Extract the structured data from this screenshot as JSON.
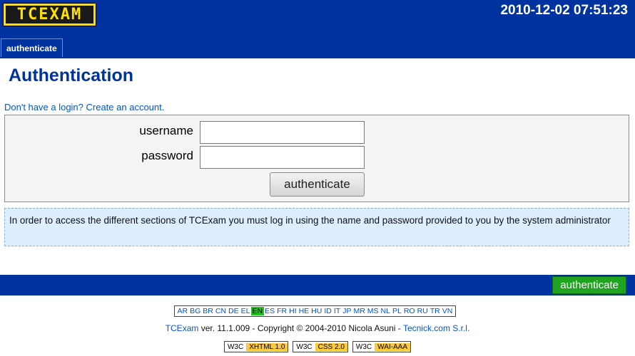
{
  "header": {
    "logo_text": "TCEXAM",
    "datetime": "2010-12-02 07:51:23",
    "menu_tab": "authenticate",
    "bg_color": "#0033a0"
  },
  "main": {
    "title": "Authentication",
    "create_account_link": "Don't have a login? Create an account.",
    "form": {
      "username_label": "username",
      "password_label": "password",
      "username_value": "",
      "password_value": "",
      "submit_label": "authenticate"
    },
    "info": "In order to access the different sections of TCExam you must log in using the name and password provided to you by the system administrator"
  },
  "footer": {
    "bar_button": "authenticate",
    "languages": [
      "AR",
      "BG",
      "BR",
      "CN",
      "DE",
      "EL",
      "EN",
      "ES",
      "FR",
      "HI",
      "HE",
      "HU",
      "ID",
      "IT",
      "JP",
      "MR",
      "MS",
      "NL",
      "PL",
      "RO",
      "RU",
      "TR",
      "VN"
    ],
    "active_language": "EN",
    "copyright": {
      "app_link": "TCExam",
      "text": " ver. 11.1.009 - Copyright © 2004-2010 Nicola Asuni - ",
      "company_link": "Tecnick.com S.r.l."
    },
    "badges": [
      {
        "org": "W3C",
        "spec": "XHTML 1.0"
      },
      {
        "org": "W3C",
        "spec": "CSS 2.0"
      },
      {
        "org": "W3C",
        "spec": "WAI-AAA"
      }
    ]
  }
}
